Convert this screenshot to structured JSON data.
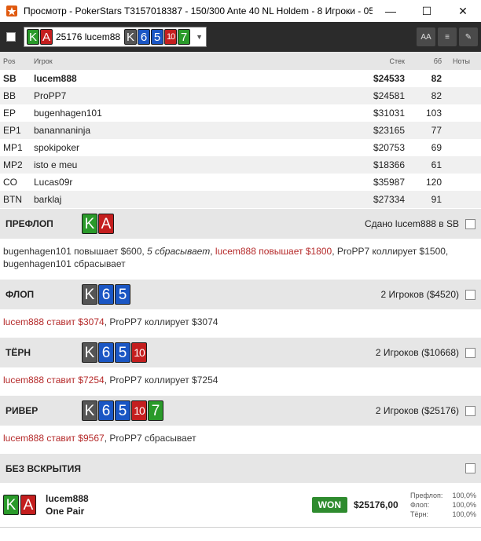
{
  "window": {
    "title": "Просмотр - PokerStars T3157018387 - 150/300 Ante 40 NL Holdem - 8 Игроки - 05...",
    "minimize": "—",
    "maximize": "☐",
    "close": "✕"
  },
  "toolbar": {
    "hand_amount": "25176 lucem88",
    "hole_cards": [
      {
        "rank": "K",
        "suit": "c"
      },
      {
        "rank": "A",
        "suit": "h"
      }
    ],
    "board_cards": [
      {
        "rank": "K",
        "suit": "s"
      },
      {
        "rank": "6",
        "suit": "d"
      },
      {
        "rank": "5",
        "suit": "d"
      },
      {
        "rank": "10",
        "suit": "h"
      },
      {
        "rank": "7",
        "suit": "c"
      }
    ],
    "btn_font": "AA",
    "btn_list": "≡",
    "btn_edit": "✎"
  },
  "table": {
    "headers": {
      "pos": "Pos",
      "name": "Игрок",
      "stack": "Стек",
      "bb": "бб",
      "notes": "Ноты"
    },
    "players": [
      {
        "pos": "SB",
        "name": "lucem888",
        "stack": "$24533",
        "bb": "82"
      },
      {
        "pos": "BB",
        "name": "ProPP7",
        "stack": "$24581",
        "bb": "82"
      },
      {
        "pos": "EP",
        "name": "bugenhagen101",
        "stack": "$31031",
        "bb": "103"
      },
      {
        "pos": "EP1",
        "name": "banannaninja",
        "stack": "$23165",
        "bb": "77"
      },
      {
        "pos": "MP1",
        "name": "spokipoker",
        "stack": "$20753",
        "bb": "69"
      },
      {
        "pos": "MP2",
        "name": "isto e meu",
        "stack": "$18366",
        "bb": "61"
      },
      {
        "pos": "CO",
        "name": "Lucas09r",
        "stack": "$35987",
        "bb": "120"
      },
      {
        "pos": "BTN",
        "name": "barklaj",
        "stack": "$27334",
        "bb": "91"
      }
    ]
  },
  "streets": {
    "preflop": {
      "name": "ПРЕФЛОП",
      "info": "Сдано lucem888 в SB",
      "a1": "bugenhagen101 повышает $600, ",
      "a2": "5 сбрасывает",
      "a3": ", ",
      "a4": "lucem888 повышает $1800",
      "a5": ", ProPP7 коллирует $1500,",
      "a6": "bugenhagen101 сбрасывает"
    },
    "flop": {
      "name": "ФЛОП",
      "info": "2 Игроков ($4520)",
      "a1": "lucem888 ставит $3074",
      "a2": ", ProPP7 коллирует $3074"
    },
    "turn": {
      "name": "ТЁРН",
      "info": "2 Игроков ($10668)",
      "a1": "lucem888 ставит $7254",
      "a2": ", ProPP7 коллирует $7254"
    },
    "river": {
      "name": "РИВЕР",
      "info": "2 Игроков ($25176)",
      "a1": "lucem888 ставит $9567",
      "a2": ", ProPP7 сбрасывает"
    },
    "showdown": {
      "name": "БЕЗ ВСКРЫТИЯ"
    }
  },
  "result": {
    "player": "lucem888",
    "hand": "One Pair",
    "badge": "WON",
    "amount": "$25176,00",
    "stats": [
      {
        "label": "Префлоп:",
        "value": "100,0%"
      },
      {
        "label": "Флоп:",
        "value": "100,0%"
      },
      {
        "label": "Тёрн:",
        "value": "100,0%"
      }
    ]
  },
  "colors": {
    "spade": "#555555",
    "heart": "#c41e1e",
    "diamond": "#1a56c4",
    "club": "#2a9a2a",
    "hero_action": "#b52a2a",
    "won_badge": "#2e8b2e"
  }
}
